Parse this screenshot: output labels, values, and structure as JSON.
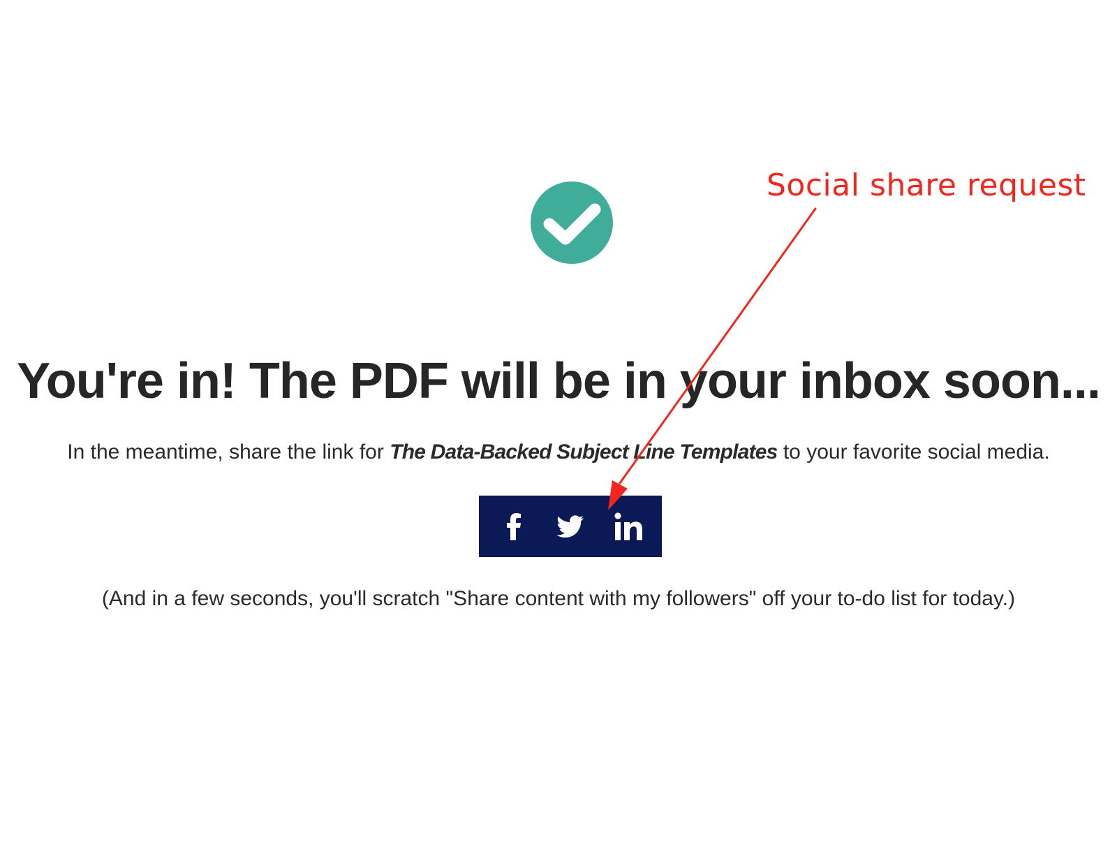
{
  "confirmation": {
    "icon": "check-circle-icon",
    "badge_color": "#3fad9a",
    "headline": "You're in! The PDF will be in your inbox soon...",
    "subline_before": "In the meantime, share the link for ",
    "subline_title": "The Data-Backed Subject Line Templates",
    "subline_after": " to your favorite social media.",
    "footnote": "(And in a few seconds, you'll scratch \"Share content with my followers\" off your to-do list for today.)"
  },
  "share": {
    "background_color": "#0b1957",
    "buttons": [
      {
        "name": "facebook",
        "icon": "facebook-icon"
      },
      {
        "name": "twitter",
        "icon": "twitter-icon"
      },
      {
        "name": "linkedin",
        "icon": "linkedin-icon"
      }
    ]
  },
  "annotation": {
    "label": "Social share request",
    "color": "#f2261d"
  }
}
